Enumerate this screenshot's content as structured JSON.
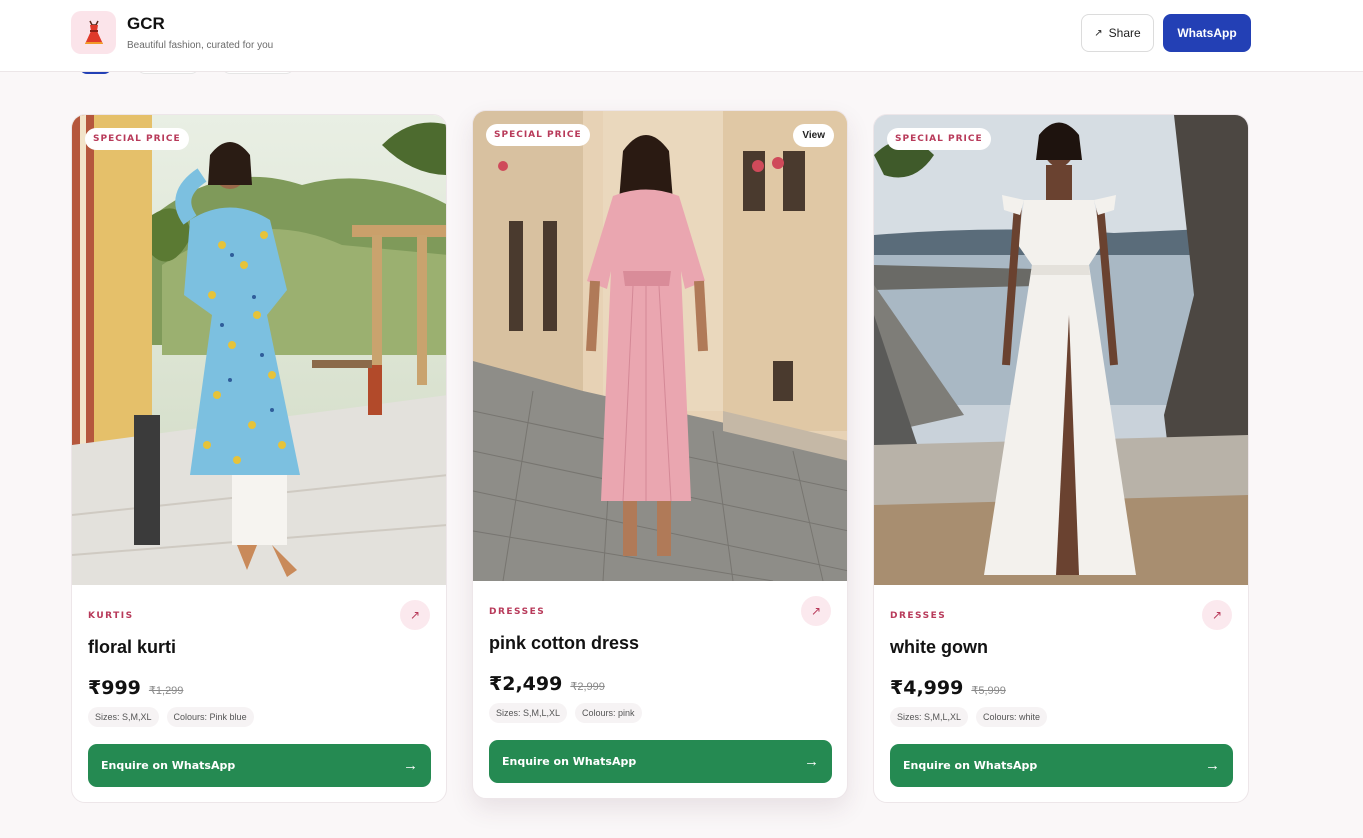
{
  "brand": {
    "name": "GCR",
    "tagline": "Beautiful fashion, curated for you",
    "logo_icon": "dress-icon"
  },
  "header": {
    "share_label": "Share",
    "share_icon": "arrow-up-right-icon",
    "whatsapp_label": "WhatsApp"
  },
  "colors": {
    "accent": "#b83a5a",
    "primary_blue": "#2340b5",
    "whatsapp_green": "#258a52",
    "background": "#faf7f8"
  },
  "products": [
    {
      "badge": "SPECIAL PRICE",
      "category": "KURTIS",
      "name": "floral kurti",
      "price": "₹999",
      "mrp": "₹1,299",
      "sizes": "Sizes: S,M,XL",
      "colours": "Colours: Pink blue",
      "cta": "Enquire on WhatsApp",
      "cta_arrow": "→",
      "corner_arrow": "↗"
    },
    {
      "badge": "SPECIAL PRICE",
      "view_label": "View",
      "category": "DRESSES",
      "name": "pink cotton dress",
      "price": "₹2,499",
      "mrp": "₹2,999",
      "sizes": "Sizes: S,M,L,XL",
      "colours": "Colours: pink",
      "cta": "Enquire on WhatsApp",
      "cta_arrow": "→",
      "corner_arrow": "↗"
    },
    {
      "badge": "SPECIAL PRICE",
      "category": "DRESSES",
      "name": "white gown",
      "price": "₹4,999",
      "mrp": "₹5,999",
      "sizes": "Sizes: S,M,L,XL",
      "colours": "Colours: white",
      "cta": "Enquire on WhatsApp",
      "cta_arrow": "→",
      "corner_arrow": "↗"
    }
  ]
}
